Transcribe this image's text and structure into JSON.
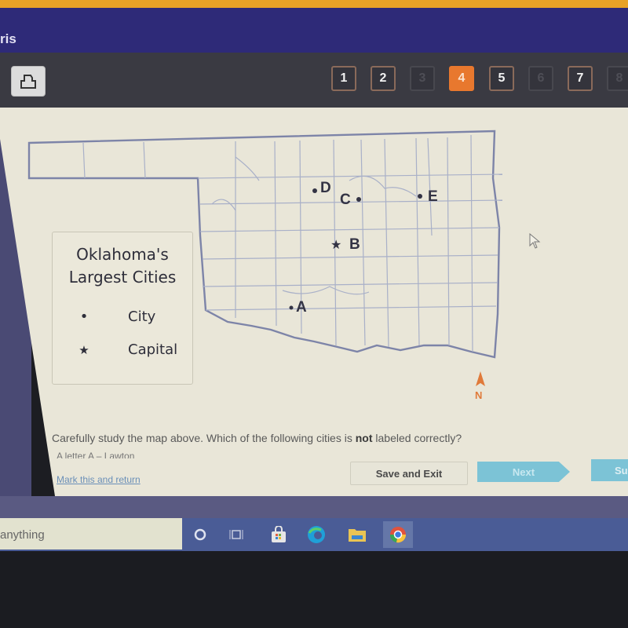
{
  "app": {
    "title_fragment": "ris"
  },
  "toolbar": {
    "print_icon": "printer-icon",
    "questions": [
      {
        "label": "1",
        "state": "normal"
      },
      {
        "label": "2",
        "state": "normal"
      },
      {
        "label": "3",
        "state": "disabled"
      },
      {
        "label": "4",
        "state": "active"
      },
      {
        "label": "5",
        "state": "normal"
      },
      {
        "label": "6",
        "state": "disabled"
      },
      {
        "label": "7",
        "state": "normal"
      },
      {
        "label": "8",
        "state": "disabled"
      }
    ],
    "active_color": "#e8782e"
  },
  "map": {
    "legend": {
      "title_line1": "Oklahoma's",
      "title_line2": "Largest Cities",
      "items": [
        {
          "symbol": "•",
          "label": "City"
        },
        {
          "symbol": "★",
          "label": "Capital"
        }
      ]
    },
    "cities": [
      {
        "label": "A",
        "marker": "dot"
      },
      {
        "label": "B",
        "marker": "star"
      },
      {
        "label": "C",
        "marker": "dot"
      },
      {
        "label": "D",
        "marker": "dot"
      },
      {
        "label": "E",
        "marker": "dot"
      }
    ],
    "compass": {
      "label": "N",
      "color": "#e07a3a"
    }
  },
  "question": {
    "text_before": "Carefully study the map above. Which of the following cities is ",
    "emphasis": "not",
    "text_after": " labeled correctly?",
    "first_option_partial": "A   letter A – Lawton"
  },
  "actions": {
    "mark_link": "Mark this and return",
    "save_exit": "Save and Exit",
    "next": "Next",
    "submit": "Su"
  },
  "taskbar": {
    "search_text": "anything",
    "icons": [
      "cortana-circle-icon",
      "task-view-icon",
      "store-icon",
      "edge-icon",
      "file-explorer-icon",
      "chrome-icon"
    ]
  }
}
